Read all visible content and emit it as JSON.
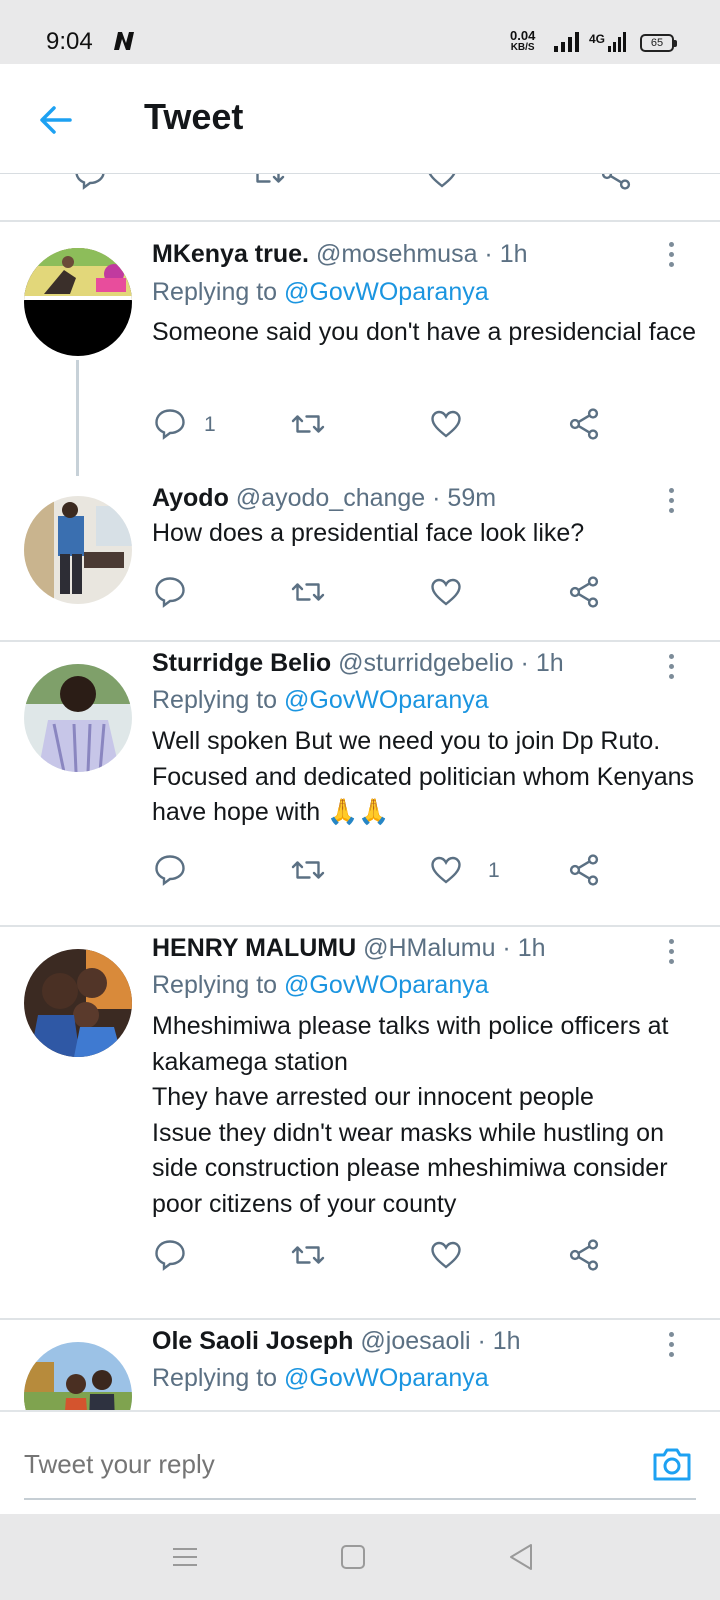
{
  "status_bar": {
    "time": "9:04",
    "net_speed_value": "0.04",
    "net_speed_unit": "KB/S",
    "network_type": "4G",
    "battery": "65"
  },
  "header": {
    "title": "Tweet"
  },
  "tweets": [
    {
      "name": "MKenya true.",
      "meta": "@mosehmusa · 1h",
      "reply_prefix": "Replying to ",
      "reply_to": "@GovWOparanya",
      "text": "Someone said you don't have a presidencial face",
      "replies": "1",
      "likes": ""
    },
    {
      "name": "Ayodo",
      "meta": "@ayodo_change · 59m",
      "text": "How does a presidential face look like?",
      "replies": "",
      "likes": ""
    },
    {
      "name": "Sturridge Belio",
      "meta": "@sturridgebelio · 1h",
      "reply_prefix": "Replying to ",
      "reply_to": "@GovWOparanya",
      "text": "Well spoken But we need you to join Dp Ruto. Focused and dedicated politician whom Kenyans have hope with 🙏🙏",
      "replies": "",
      "likes": "1"
    },
    {
      "name": "HENRY MALUMU",
      "meta": "@HMalumu · 1h",
      "reply_prefix": "Replying to ",
      "reply_to": "@GovWOparanya",
      "text": "Mheshimiwa please talks with police officers at kakamega station\nThey have arrested our innocent people\nIssue they didn't wear masks while hustling on side construction please mheshimiwa consider poor citizens of your county",
      "replies": "",
      "likes": ""
    },
    {
      "name": "Ole Saoli Joseph",
      "meta": "@joesaoli · 1h",
      "reply_prefix": "Replying to ",
      "reply_to": "@GovWOparanya"
    }
  ],
  "composer": {
    "placeholder": "Tweet your reply"
  },
  "colors": {
    "accent": "#1da1f2",
    "mention": "#1b95e0",
    "secondary_text": "#5b7083",
    "icon": "#5b7083"
  }
}
